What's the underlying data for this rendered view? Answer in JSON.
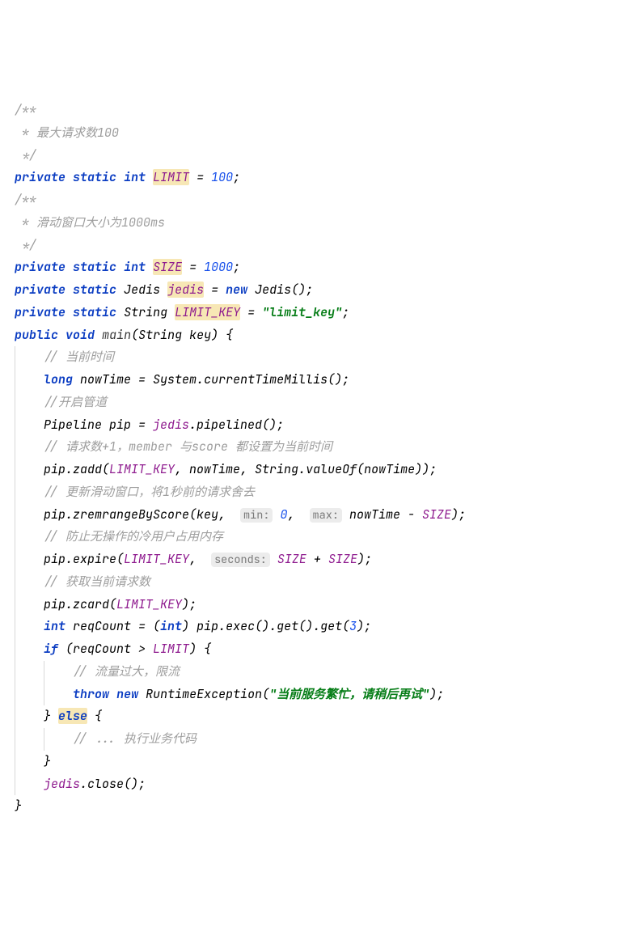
{
  "lines": {
    "l1": "/**",
    "l2_pre": " * ",
    "l2_txt": "最大请求数100",
    "l3": " */",
    "l4_kw1": "private",
    "l4_kw2": "static",
    "l4_type": "int",
    "l4_field": "LIMIT",
    "l4_eq": " = ",
    "l4_num": "100",
    "l4_sc": ";",
    "l5": "/**",
    "l6_pre": " * ",
    "l6_txt": "滑动窗口大小为1000ms",
    "l7": " */",
    "l8_kw1": "private",
    "l8_kw2": "static",
    "l8_type": "int",
    "l8_field": "SIZE",
    "l8_eq": " = ",
    "l8_num": "1000",
    "l8_sc": ";",
    "l9_kw1": "private",
    "l9_kw2": "static",
    "l9_type": "Jedis",
    "l9_field": "jedis",
    "l9_eq": " = ",
    "l9_new": "new",
    "l9_ctor": "Jedis",
    "l9_paren": "();",
    "l10_kw1": "private",
    "l10_kw2": "static",
    "l10_type": "String",
    "l10_field": "LIMIT_KEY",
    "l10_eq": " = ",
    "l10_str": "\"limit_key\"",
    "l10_sc": ";",
    "l11_kw1": "public",
    "l11_kw2": "void",
    "l11_name": "main",
    "l11_p1": "(String key) {",
    "l12_c": "// 当前时间",
    "l13_type": "long",
    "l13_var": "nowTime = System.",
    "l13_m": "currentTimeMillis",
    "l13_end": "();",
    "l14_c": "//开启管道",
    "l15_a": "Pipeline pip = ",
    "l15_f": "jedis",
    "l15_b": ".pipelined();",
    "l16_c": "// 请求数+1，member 与score 都设置为当前时间",
    "l17_a": "pip.zadd(",
    "l17_f": "LIMIT_KEY",
    "l17_b": ", nowTime, String.",
    "l17_m": "valueOf",
    "l17_c2": "(nowTime));",
    "l18_c": "// 更新滑动窗口，将1秒前的请求舍去",
    "l19_a": "pip.zremrangeByScore(key, ",
    "l19_h1": "min:",
    "l19_sp1": " ",
    "l19_n1": "0",
    "l19_b": ", ",
    "l19_h2": "max:",
    "l19_sp2": " ",
    "l19_c2": "nowTime - ",
    "l19_f": "SIZE",
    "l19_d": ");",
    "l20_c": "// 防止无操作的冷用户占用内存",
    "l21_a": "pip.expire(",
    "l21_f": "LIMIT_KEY",
    "l21_b": ", ",
    "l21_h": "seconds:",
    "l21_sp": " ",
    "l21_f2": "SIZE",
    "l21_plus": " + ",
    "l21_f3": "SIZE",
    "l21_d": ");",
    "l22_c": "// 获取当前请求数",
    "l23_a": "pip.zcard(",
    "l23_f": "LIMIT_KEY",
    "l23_b": ");",
    "l24_type": "int",
    "l24_a": " reqCount = (",
    "l24_cast": "int",
    "l24_b": ") pip.exec().get().get(",
    "l24_n": "3",
    "l24_c2": ");",
    "l25_if": "if",
    "l25_a": " (reqCount > ",
    "l25_f": "LIMIT",
    "l25_b": ") {",
    "l26_c": "// 流量过大，限流",
    "l27_throw": "throw",
    "l27_new": "new",
    "l27_ex": "RuntimeException(",
    "l27_str": "\"当前服务繁忙，请稍后再试\"",
    "l27_end": ");",
    "l28_a": "} ",
    "l28_else": "else",
    "l28_b": " {",
    "l29_c": "// ... 执行业务代码",
    "l30": "}",
    "l31_f": "jedis",
    "l31_a": ".close();",
    "l32": "}"
  }
}
